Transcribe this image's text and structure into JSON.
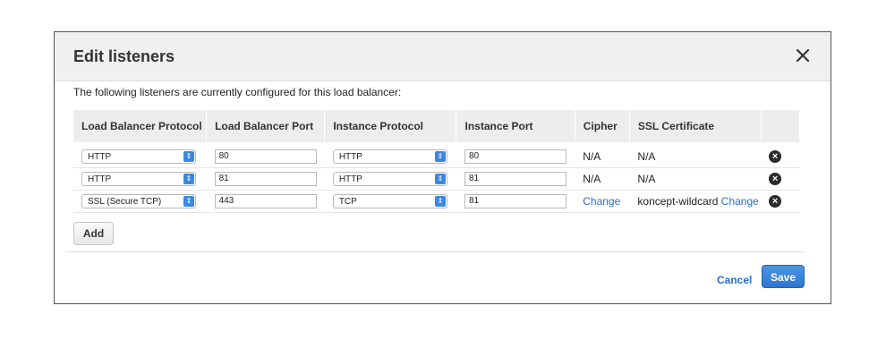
{
  "dialog": {
    "title": "Edit listeners",
    "close_icon": "close-icon",
    "intro": "The following listeners are currently configured for this load balancer:"
  },
  "table": {
    "headers": [
      "Load Balancer Protocol",
      "Load Balancer Port",
      "Instance Protocol",
      "Instance Port",
      "Cipher",
      "SSL Certificate"
    ],
    "rows": [
      {
        "lb_protocol": "HTTP",
        "lb_port": "80",
        "instance_protocol": "HTTP",
        "instance_port": "80",
        "cipher": "N/A",
        "cert": "N/A",
        "cert_link": ""
      },
      {
        "lb_protocol": "HTTP",
        "lb_port": "81",
        "instance_protocol": "HTTP",
        "instance_port": "81",
        "cipher": "N/A",
        "cert": "N/A",
        "cert_link": ""
      },
      {
        "lb_protocol": "SSL (Secure TCP)",
        "lb_port": "443",
        "instance_protocol": "TCP",
        "instance_port": "81",
        "cipher": "Change",
        "cert": "koncept-wildcard",
        "cert_link": "Change"
      }
    ],
    "remove_icon": "remove-circle-icon"
  },
  "actions": {
    "add": "Add",
    "cancel": "Cancel",
    "save": "Save"
  },
  "colors": {
    "link": "#2a6fc1",
    "primary": "#2c75d3"
  }
}
